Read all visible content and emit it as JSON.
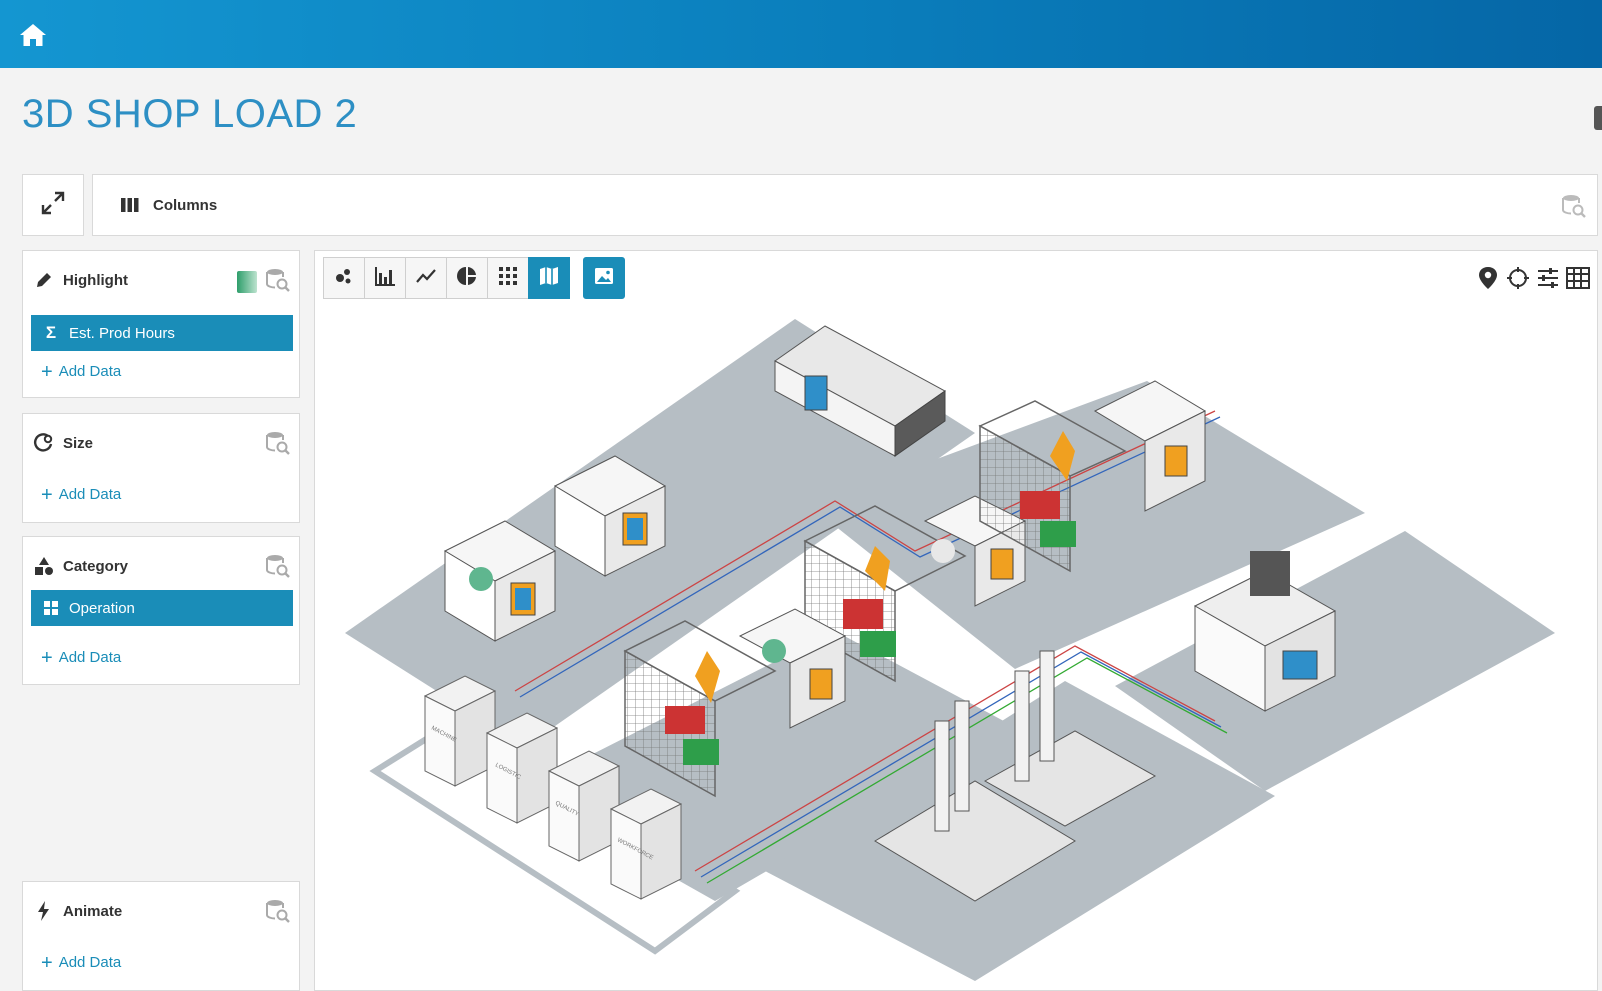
{
  "page": {
    "title": "3D SHOP LOAD 2"
  },
  "toolbar": {
    "columns_label": "Columns"
  },
  "wells": {
    "highlight": {
      "label": "Highlight",
      "pill": "Est. Prod Hours",
      "add": "Add Data"
    },
    "size": {
      "label": "Size",
      "add": "Add Data"
    },
    "category": {
      "label": "Category",
      "pill": "Operation",
      "add": "Add Data"
    },
    "animate": {
      "label": "Animate",
      "add": "Add Data"
    }
  },
  "viz_types": [
    "scatter-icon",
    "bar-chart-icon",
    "line-chart-icon",
    "pie-chart-icon",
    "grid-icon",
    "map-icon",
    "image-icon"
  ],
  "active_viz": "map-icon",
  "floor_labels": [
    "MACHINE",
    "LOGISTIC",
    "QUALITY",
    "WORKFORCE"
  ],
  "colors": {
    "brand": "#1a8db8",
    "topbar": "#0a7dbb",
    "highlight_green": "#2e9e6b"
  }
}
